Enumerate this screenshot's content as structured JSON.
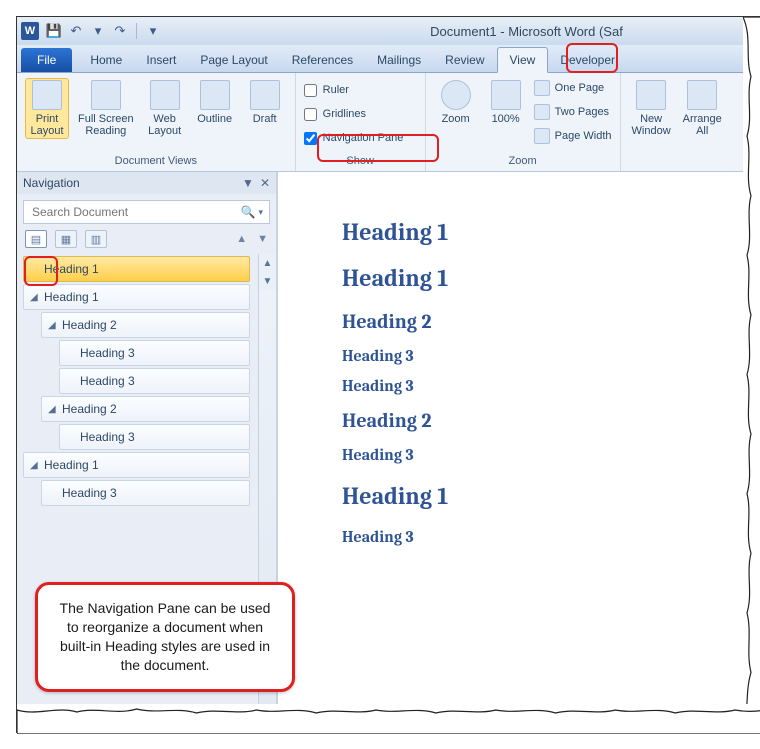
{
  "title": "Document1 - Microsoft Word (Saf",
  "qat": {
    "save": "💾",
    "undo": "↶",
    "redo": "↷"
  },
  "tabs": {
    "file": "File",
    "home": "Home",
    "insert": "Insert",
    "page_layout": "Page Layout",
    "references": "References",
    "mailings": "Mailings",
    "review": "Review",
    "view": "View",
    "developer": "Developer"
  },
  "ribbon": {
    "views": {
      "label": "Document Views",
      "print_layout": "Print\nLayout",
      "full_screen": "Full Screen\nReading",
      "web_layout": "Web\nLayout",
      "outline": "Outline",
      "draft": "Draft"
    },
    "show": {
      "label": "Show",
      "ruler": "Ruler",
      "gridlines": "Gridlines",
      "navpane": "Navigation Pane"
    },
    "zoom": {
      "label": "Zoom",
      "zoom": "Zoom",
      "hundred": "100%",
      "one_page": "One Page",
      "two_pages": "Two Pages",
      "page_width": "Page Width"
    },
    "window": {
      "new_window": "New\nWindow",
      "arrange_all": "Arrange\nAll"
    }
  },
  "nav": {
    "title": "Navigation",
    "search_placeholder": "Search Document",
    "items": [
      {
        "lvl": 0,
        "text": "Heading 1",
        "sel": true,
        "tw": ""
      },
      {
        "lvl": 0,
        "text": "Heading 1",
        "tw": "◢"
      },
      {
        "lvl": 1,
        "text": "Heading 2",
        "tw": "◢"
      },
      {
        "lvl": 2,
        "text": "Heading 3",
        "tw": ""
      },
      {
        "lvl": 2,
        "text": "Heading 3",
        "tw": ""
      },
      {
        "lvl": 1,
        "text": "Heading 2",
        "tw": "◢"
      },
      {
        "lvl": 2,
        "text": "Heading 3",
        "tw": ""
      },
      {
        "lvl": 0,
        "text": "Heading 1",
        "tw": "◢"
      },
      {
        "lvl": 1,
        "text": "Heading 3",
        "tw": ""
      }
    ]
  },
  "doc": [
    {
      "cls": "h1",
      "text": "Heading 1"
    },
    {
      "cls": "h1",
      "text": "Heading 1"
    },
    {
      "cls": "h2",
      "text": "Heading 2"
    },
    {
      "cls": "h3",
      "text": "Heading 3"
    },
    {
      "cls": "h3",
      "text": "Heading 3"
    },
    {
      "cls": "h2",
      "text": "Heading 2"
    },
    {
      "cls": "h3",
      "text": "Heading 3"
    },
    {
      "cls": "h1",
      "text": "Heading 1"
    },
    {
      "cls": "h3",
      "text": "Heading 3"
    }
  ],
  "callout": "The Navigation Pane can be used to reorganize a document when built-in Heading styles are used in the document."
}
